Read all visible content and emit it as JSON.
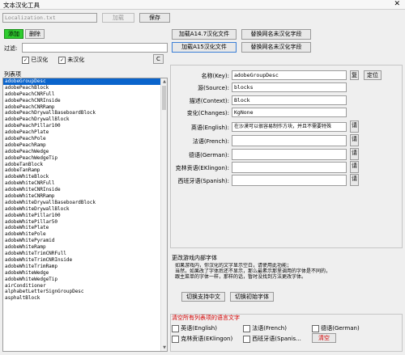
{
  "window": {
    "title": "文本汉化工具",
    "close": "✕"
  },
  "toolbar": {
    "file": "Localization.txt",
    "load": "加载",
    "save": "保存"
  },
  "actions": {
    "add": "添加",
    "remove": "删除",
    "load_a14": "加载A14.7汉化文件",
    "replace_a14": "替换网名未汉化字段",
    "load_a15": "加载A15汉化文件",
    "replace_a15": "替换网名未汉化字段"
  },
  "filter": {
    "label": "过滤:",
    "value": "",
    "translated": "已汉化",
    "untranslated": "未汉化",
    "clear": "C"
  },
  "list": {
    "header": "列表项",
    "selected_index": 0,
    "items": [
      "adobeGroupDesc",
      "adobePeachBlock",
      "adobePeachCNRFull",
      "adobePeachCNRInside",
      "adobePeachCNRRamp",
      "adobePeachDrywallBaseboardBlock",
      "adobePeachDrywallBlock",
      "adobePeachPillar100",
      "adobePeachPlate",
      "adobePeachPole",
      "adobePeachRamp",
      "adobePeachWedge",
      "adobePeachWedgeTip",
      "adobeTanBlock",
      "adobeTanRamp",
      "adobeWhiteBlock",
      "adobeWhiteCNRFull",
      "adobeWhiteCNRInside",
      "adobeWhiteCNRRamp",
      "adobeWhiteDrywallBaseboardBlock",
      "adobeWhiteDrywallBlock",
      "adobeWhitePillar100",
      "adobeWhitePillar50",
      "adobeWhitePlate",
      "adobeWhitePole",
      "adobeWhitePyramid",
      "adobeWhiteRamp",
      "adobeWhiteTrimCNRFull",
      "adobeWhiteTrimCNRInside",
      "adobeWhiteTrimRamp",
      "adobeWhiteWedge",
      "adobeWhiteWedgeTip",
      "airConditioner",
      "alphabetLetterSignGroupDesc",
      "asphaltBlock"
    ]
  },
  "form": {
    "name_label": "名称(Key):",
    "name_value": "adobeGroupDesc",
    "copy": "复",
    "locate": "定位",
    "source_label": "源(Source):",
    "source_value": "blocks",
    "context_label": "描述(Context):",
    "context_value": "Block",
    "changes_label": "变化(Changes):",
    "changes_value": "KgNone",
    "english_label": "英语(English):",
    "english_value": "在沙漠可以很容易制作方块，并且不需要特殊",
    "french_label": "法语(French):",
    "french_value": "",
    "german_label": "德语(German):",
    "german_value": "",
    "klingon_label": "克林贡语(EKlingon):",
    "klingon_value": "",
    "spanish_label": "西班牙语(Spanish):",
    "spanish_value": "",
    "req": "请"
  },
  "font_section": {
    "title": "更改游戏内部字体",
    "desc": "如果游戏内，你汉化的文字显示空白，请使用此功能；\n当然，如果改了字体后还不显示，那么最素示那里调用的字体是不同的，\n跟主菜单的字体一样，那样的话，暂时没找到方法更改字体。",
    "switch_cn": "切换支持中文",
    "switch_default": "切换初始字体"
  },
  "clear_section": {
    "title": "清空所有列表项的语言文字",
    "english": "英语(English)",
    "french": "法语(French)",
    "german": "德语(German)",
    "klingon": "克林贡语(EKlingon)",
    "spanish": "西班牙语(Spanis...",
    "clear": "清空"
  }
}
